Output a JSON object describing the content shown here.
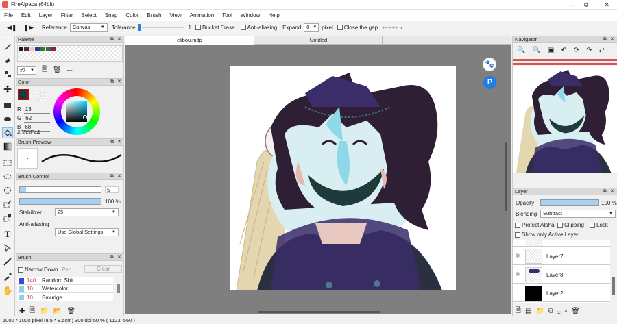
{
  "app": {
    "title": "FireAlpaca (64bit)"
  },
  "menu": [
    "File",
    "Edit",
    "Layer",
    "Filter",
    "Select",
    "Snap",
    "Color",
    "Brush",
    "View",
    "Animation",
    "Tool",
    "Window",
    "Help"
  ],
  "toolbar": {
    "reference_label": "Reference",
    "reference_value": "Canvas",
    "tolerance_label": "Tolerance",
    "tolerance_value": "1",
    "bucket_erase": "Bucket Erase",
    "antialiasing": "Anti-aliasing",
    "expand_label": "Expand",
    "expand_value": "0",
    "expand_unit": "pixel",
    "close_gap": "Close the gap",
    "close_gap_value": "+++++"
  },
  "palette": {
    "title": "Palette",
    "swatches": [
      "#1a1a1a",
      "#4a2e2e",
      "#f0c8d0",
      "#2d3a8c",
      "#2a7a3a",
      "#3a6a3a",
      "#8c2040"
    ],
    "index": "#7",
    "dashes": "---"
  },
  "color": {
    "title": "Color",
    "r_label": "R",
    "r_value": "13",
    "g_label": "G",
    "g_value": "62",
    "b_label": "B",
    "b_value": "68",
    "hex": "#0D3E44",
    "current": "#0D3E44"
  },
  "brush_preview": {
    "title": "Brush Preview"
  },
  "brush_control": {
    "title": "Brush Control",
    "size_value": "5",
    "opacity_value": "100 %",
    "opacity": 1.0,
    "stabilizer_label": "Stabilizer",
    "stabilizer_value": "25",
    "antialiasing_label": "Anti-aliasing",
    "antialiasing_value": "Use Global Settings"
  },
  "brush": {
    "title": "Brush",
    "narrow_down": "Narrow Down",
    "pen": "Pen",
    "clear": "Clear",
    "items": [
      {
        "size": "140",
        "name": "Random Shit",
        "color": "#3a4ad0"
      },
      {
        "size": "10",
        "name": "Watercolor",
        "color": "#8fd0e8"
      },
      {
        "size": "10",
        "name": "Smudge",
        "color": "#8fd0e8"
      }
    ]
  },
  "tabs": [
    {
      "label": "elibou.mdp"
    },
    {
      "label": "Untitled"
    }
  ],
  "navigator": {
    "title": "Navigator"
  },
  "layer": {
    "title": "Layer",
    "opacity_label": "Opacity",
    "opacity_value": "100 %",
    "opacity": 1.0,
    "blending_label": "Blending",
    "blending_value": "Subtract",
    "protect_alpha": "Protect Alpha",
    "clipping": "Clipping",
    "lock": "Lock",
    "show_only_active": "Show only Active Layer",
    "layers": [
      {
        "name": "Layer7"
      },
      {
        "name": "Layer8"
      },
      {
        "name": "Layer2"
      }
    ]
  },
  "status": {
    "text": "1000 * 1000 pixel   (8.5 * 8.5cm)  300 dpi   50 %   ( 1123, 560 )"
  }
}
